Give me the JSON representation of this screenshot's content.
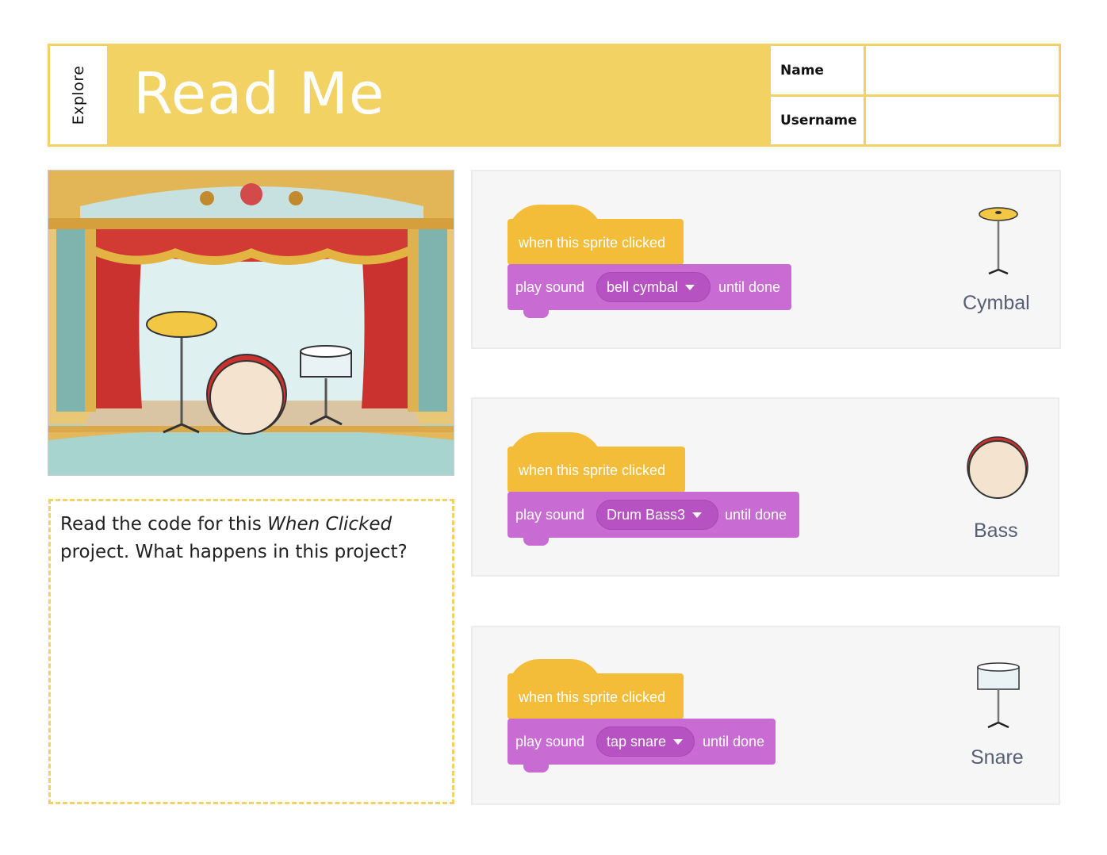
{
  "header": {
    "tab_label": "Explore",
    "title": "Read Me",
    "name_label": "Name",
    "username_label": "Username"
  },
  "prompt": {
    "part1": "Read the code for this ",
    "emphasis": "When Clicked",
    "part2": " project. What happens in this project?"
  },
  "panels": [
    {
      "hat": "when this sprite clicked",
      "play": "play sound",
      "sound": "bell cymbal",
      "until": "until done",
      "instrument": "Cymbal"
    },
    {
      "hat": "when this sprite clicked",
      "play": "play sound",
      "sound": "Drum Bass3",
      "until": "until done",
      "instrument": "Bass"
    },
    {
      "hat": "when this sprite clicked",
      "play": "play sound",
      "sound": "tap snare",
      "until": "until done",
      "instrument": "Snare"
    }
  ],
  "colors": {
    "accent_yellow": "#f2d263",
    "events_block": "#f3bd3a",
    "sound_block": "#c86bd3",
    "sound_dropdown": "#b652c2",
    "label_gray": "#575e75"
  }
}
